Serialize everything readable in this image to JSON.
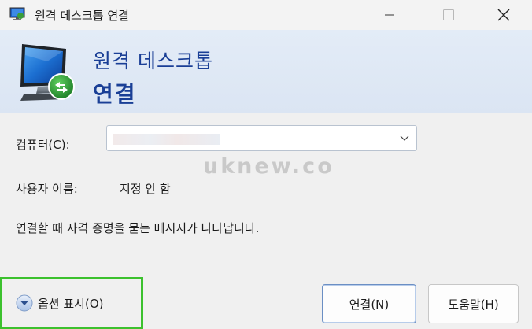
{
  "window": {
    "title": "원격 데스크톱 연결",
    "controls": {
      "minimize": "minimize-icon",
      "maximize": "maximize-icon",
      "close": "close-icon"
    }
  },
  "banner": {
    "line1": "원격 데스크톱",
    "line2": "연결"
  },
  "form": {
    "computer_label": "컴퓨터(C):",
    "computer_value": "",
    "username_label": "사용자 이름:",
    "username_value": "지정 안 함",
    "info_text": "연결할 때 자격 증명을 묻는 메시지가 나타납니다."
  },
  "watermark": "uknew.co",
  "footer": {
    "options_label_prefix": "옵션 표시(",
    "options_label_key": "O",
    "options_label_suffix": ")",
    "connect_button": "연결(N)",
    "help_button": "도움말(H)"
  },
  "colors": {
    "banner_text": "#1a3f96",
    "highlight_box": "#3cc12e",
    "primary_button_border": "#6b8fc4"
  }
}
